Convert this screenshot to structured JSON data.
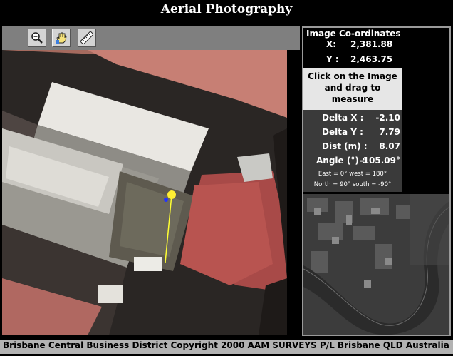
{
  "title": "Aerial Photography",
  "toolbar": {
    "tools": [
      {
        "name": "zoom-out",
        "icon": "magnifier-minus-icon"
      },
      {
        "name": "pan",
        "icon": "hand-icon"
      },
      {
        "name": "measure",
        "icon": "ruler-icon"
      }
    ]
  },
  "coordinates": {
    "heading": "Image Co-ordinates",
    "x_label": "X:",
    "x_value": "2,381.88",
    "y_label": "Y :",
    "y_value": "2,463.75"
  },
  "instruction": {
    "line1": "Click on the Image",
    "line2": "and drag to measure"
  },
  "measurement": {
    "delta_x_label": "Delta X :",
    "delta_x_value": "-2.10",
    "delta_y_label": "Delta Y :",
    "delta_y_value": "7.79",
    "dist_label": "Dist (m) :",
    "dist_value": "8.07",
    "angle_label": "Angle (°) :",
    "angle_value": "-105.09°",
    "note1": "East = 0° west = 180°",
    "note2": "North = 90° south = -90°"
  },
  "footer": "Brisbane Central Business District Copyright 2000 AAM SURVEYS P/L Brisbane QLD Australia",
  "colors": {
    "background": "#000000",
    "toolbar": "#7f7f7f",
    "instruction_bg": "#e6e6e6",
    "measure_bg": "#3a3a3a",
    "footer_bg": "#b3b3b3",
    "measure_line": "#ffff33",
    "measure_start": "#2233ff"
  }
}
